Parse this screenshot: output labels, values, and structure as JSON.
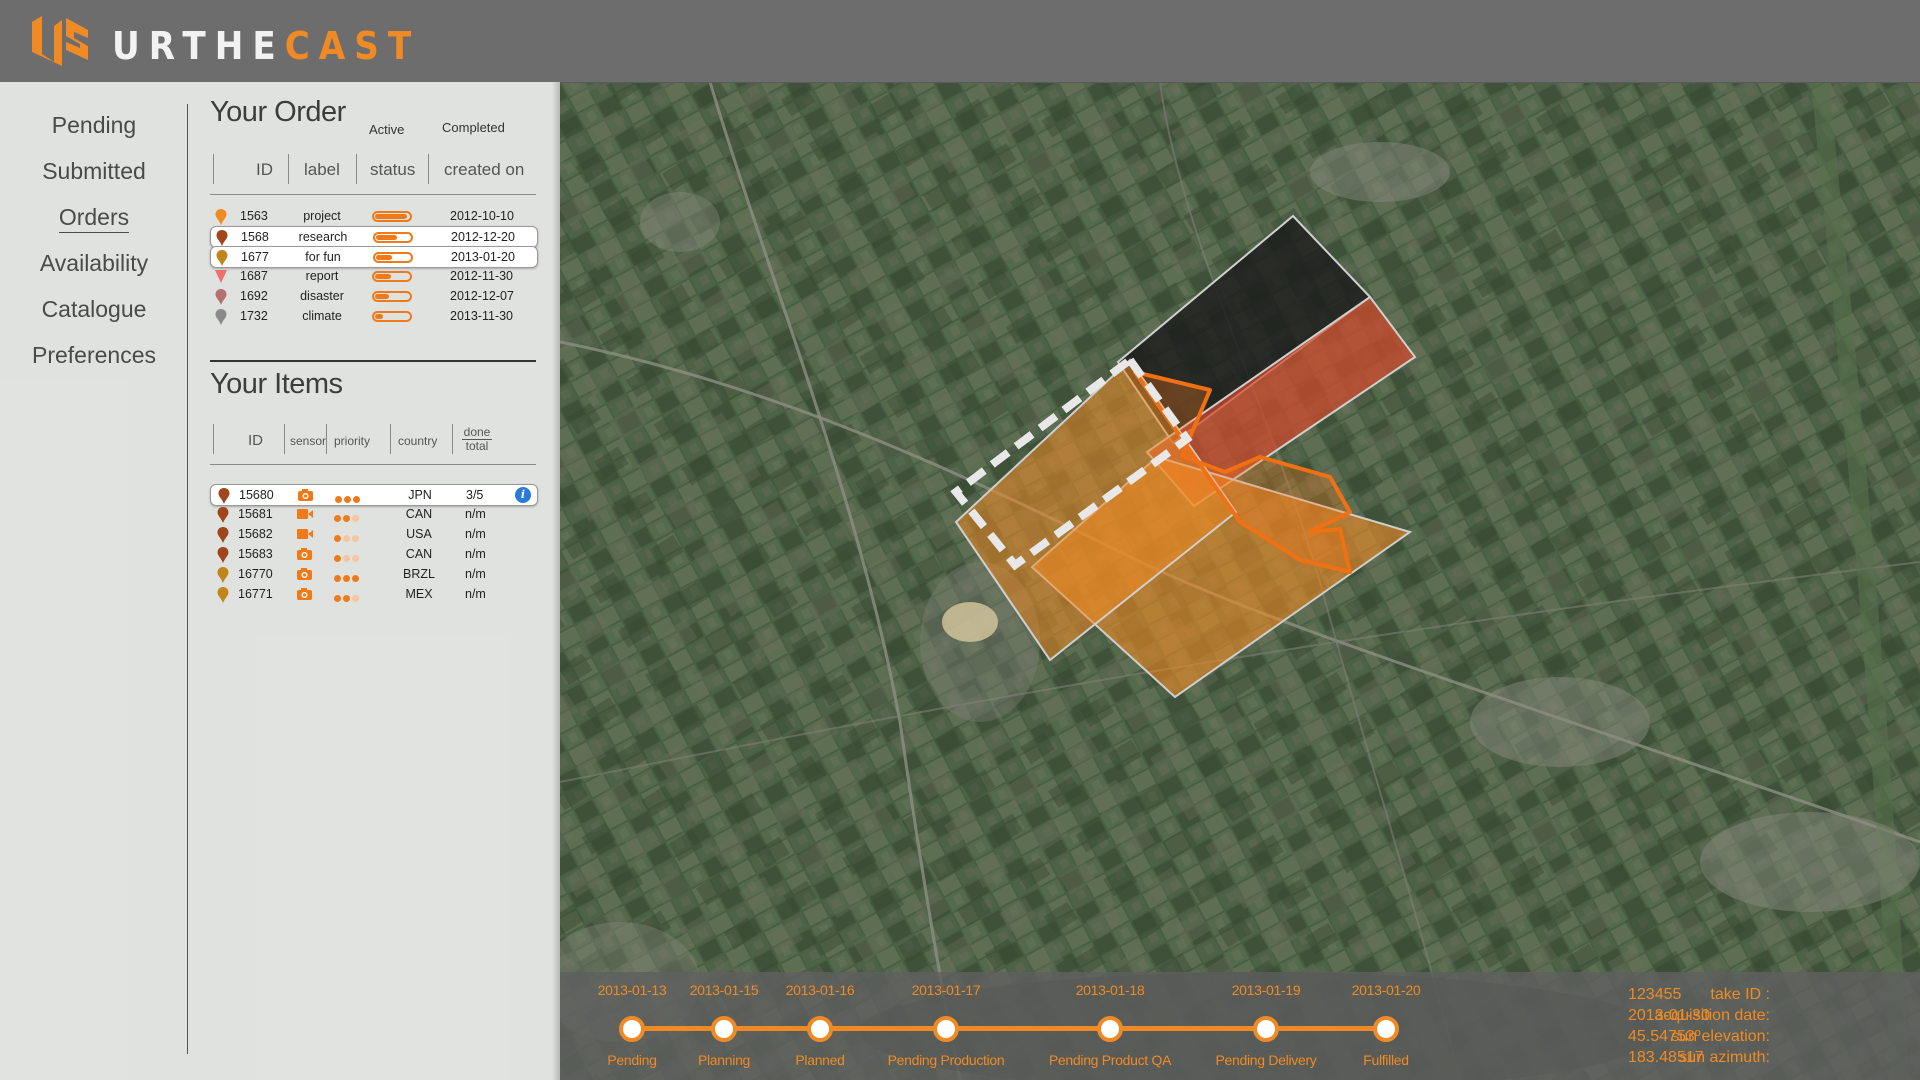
{
  "brand": {
    "part1": "URTHE",
    "part2": "CAST",
    "accent": "#f08a24"
  },
  "nav": {
    "items": [
      "Pending",
      "Submitted",
      "Orders",
      "Availability",
      "Catalogue",
      "Preferences"
    ],
    "active": "Orders"
  },
  "order": {
    "title": "Your Order",
    "tabs": [
      "Active",
      "Completed"
    ],
    "columns": [
      "ID",
      "label",
      "status",
      "created on"
    ],
    "rows": [
      {
        "id": "1563",
        "label": "project",
        "status_progress": 1.0,
        "created": "2012-10-10",
        "pin_color": "#f08a24",
        "pin_icon": "pin-icon"
      },
      {
        "id": "1568",
        "label": "research",
        "status_progress": 0.65,
        "created": "2012-12-20",
        "pin_color": "#a0461c",
        "pin_icon": "pin-icon"
      },
      {
        "id": "1677",
        "label": "for fun",
        "status_progress": 0.5,
        "created": "2013-01-20",
        "pin_color": "#c0861c",
        "pin_icon": "pin-icon"
      },
      {
        "id": "1687",
        "label": "report",
        "status_progress": 0.5,
        "created": "2012-11-30",
        "pin_color": "#f0706e",
        "pin_icon": "triangle-marker-icon"
      },
      {
        "id": "1692",
        "label": "disaster",
        "status_progress": 0.45,
        "created": "2012-12-07",
        "pin_color": "#b57070",
        "pin_icon": "pin-icon"
      },
      {
        "id": "1732",
        "label": "climate",
        "status_progress": 0.25,
        "created": "2013-11-30",
        "pin_color": "#8a8a8a",
        "pin_icon": "pin-icon"
      }
    ]
  },
  "items": {
    "title": "Your Items",
    "columns": {
      "id": "ID",
      "sensor": "sensor",
      "priority": "priority",
      "country": "country",
      "done": "done",
      "total": "total"
    },
    "rows": [
      {
        "id": "15680",
        "sensor": "camera-icon",
        "priority": 3,
        "country": "JPN",
        "progress": "3/5",
        "pin_color": "#a0461c",
        "info": "i"
      },
      {
        "id": "15681",
        "sensor": "video-icon",
        "priority": 2,
        "country": "CAN",
        "progress": "n/m",
        "pin_color": "#a0461c"
      },
      {
        "id": "15682",
        "sensor": "video-icon",
        "priority": 1,
        "country": "USA",
        "progress": "n/m",
        "pin_color": "#a0461c"
      },
      {
        "id": "15683",
        "sensor": "camera-icon",
        "priority": 1,
        "country": "CAN",
        "progress": "n/m",
        "pin_color": "#a0461c"
      },
      {
        "id": "16770",
        "sensor": "camera-icon",
        "priority": 3,
        "country": "BRZL",
        "progress": "n/m",
        "pin_color": "#c0861c"
      },
      {
        "id": "16771",
        "sensor": "camera-icon",
        "priority": 2,
        "country": "MEX",
        "progress": "n/m",
        "pin_color": "#c0861c"
      }
    ]
  },
  "timeline": {
    "dates": [
      "2013-01-13",
      "2013-01-15",
      "2013-01-16",
      "2013-01-17",
      "2013-01-18",
      "2013-01-19",
      "2013-01-20"
    ],
    "stages": [
      "Pending",
      "Planning",
      "Planned",
      "Pending Production",
      "Pending Product QA",
      "Pending Delivery",
      "Fulfilled"
    ]
  },
  "meta": {
    "take_id_label": "take ID :",
    "take_id": "123455",
    "acq_label": "acquisition date:",
    "acq": "2013-01-30",
    "elev_label": "sun elevation:",
    "elev": "45.54753º",
    "azim_label": "sun azimuth:",
    "azim": "183.48517"
  }
}
